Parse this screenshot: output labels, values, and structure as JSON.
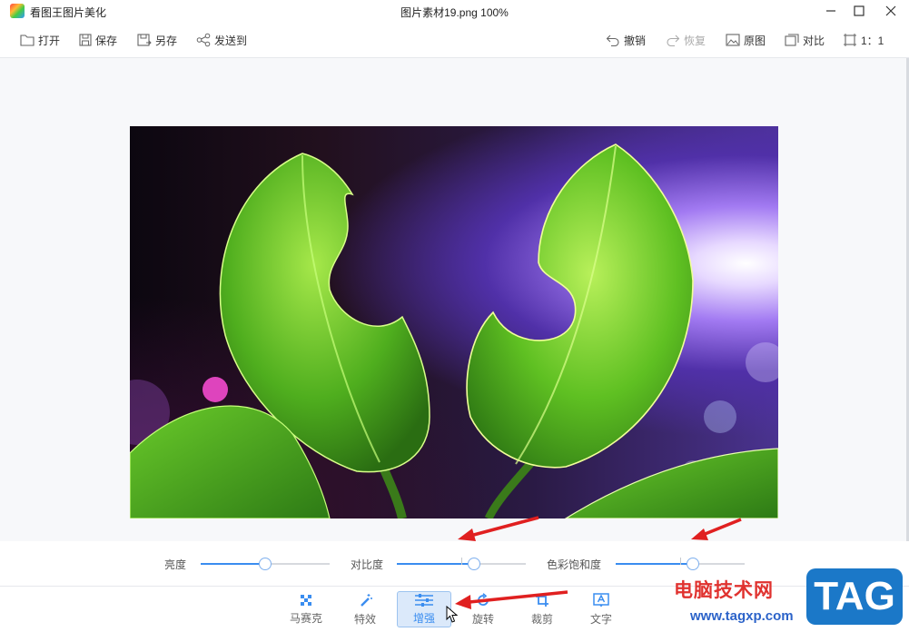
{
  "titlebar": {
    "app_name": "看图王图片美化",
    "document_title": "图片素材19.png   100%"
  },
  "toolbar": {
    "left": [
      {
        "label": "打开",
        "icon": "folder-icon"
      },
      {
        "label": "保存",
        "icon": "save-icon"
      },
      {
        "label": "另存",
        "icon": "save-as-icon"
      },
      {
        "label": "发送到",
        "icon": "share-icon"
      }
    ],
    "right": [
      {
        "label": "撤销",
        "icon": "undo-icon",
        "enabled": true
      },
      {
        "label": "恢复",
        "icon": "redo-icon",
        "enabled": false
      },
      {
        "label": "原图",
        "icon": "image-icon",
        "enabled": true
      },
      {
        "label": "对比",
        "icon": "compare-icon",
        "enabled": true
      },
      {
        "label": "1：1",
        "icon": "actual-size-icon",
        "enabled": true
      }
    ]
  },
  "adjust": {
    "brightness_label": "亮度",
    "brightness_value": 0.5,
    "contrast_label": "对比度",
    "contrast_value": 0.6,
    "saturation_label": "色彩饱和度",
    "saturation_value": 0.6
  },
  "tools": [
    {
      "label": "马赛克",
      "icon": "mosaic-icon",
      "active": false
    },
    {
      "label": "特效",
      "icon": "magic-wand-icon",
      "active": false
    },
    {
      "label": "增强",
      "icon": "sliders-icon",
      "active": true
    },
    {
      "label": "旋转",
      "icon": "rotate-icon",
      "active": false
    },
    {
      "label": "裁剪",
      "icon": "crop-icon",
      "active": false
    },
    {
      "label": "文字",
      "icon": "text-icon",
      "active": false
    }
  ],
  "watermark": {
    "site_name": "电脑技术网",
    "url": "www.tagxp.com",
    "tag": "TAG"
  },
  "colors": {
    "accent": "#3a8df0",
    "annotation_arrow": "#e02020"
  }
}
